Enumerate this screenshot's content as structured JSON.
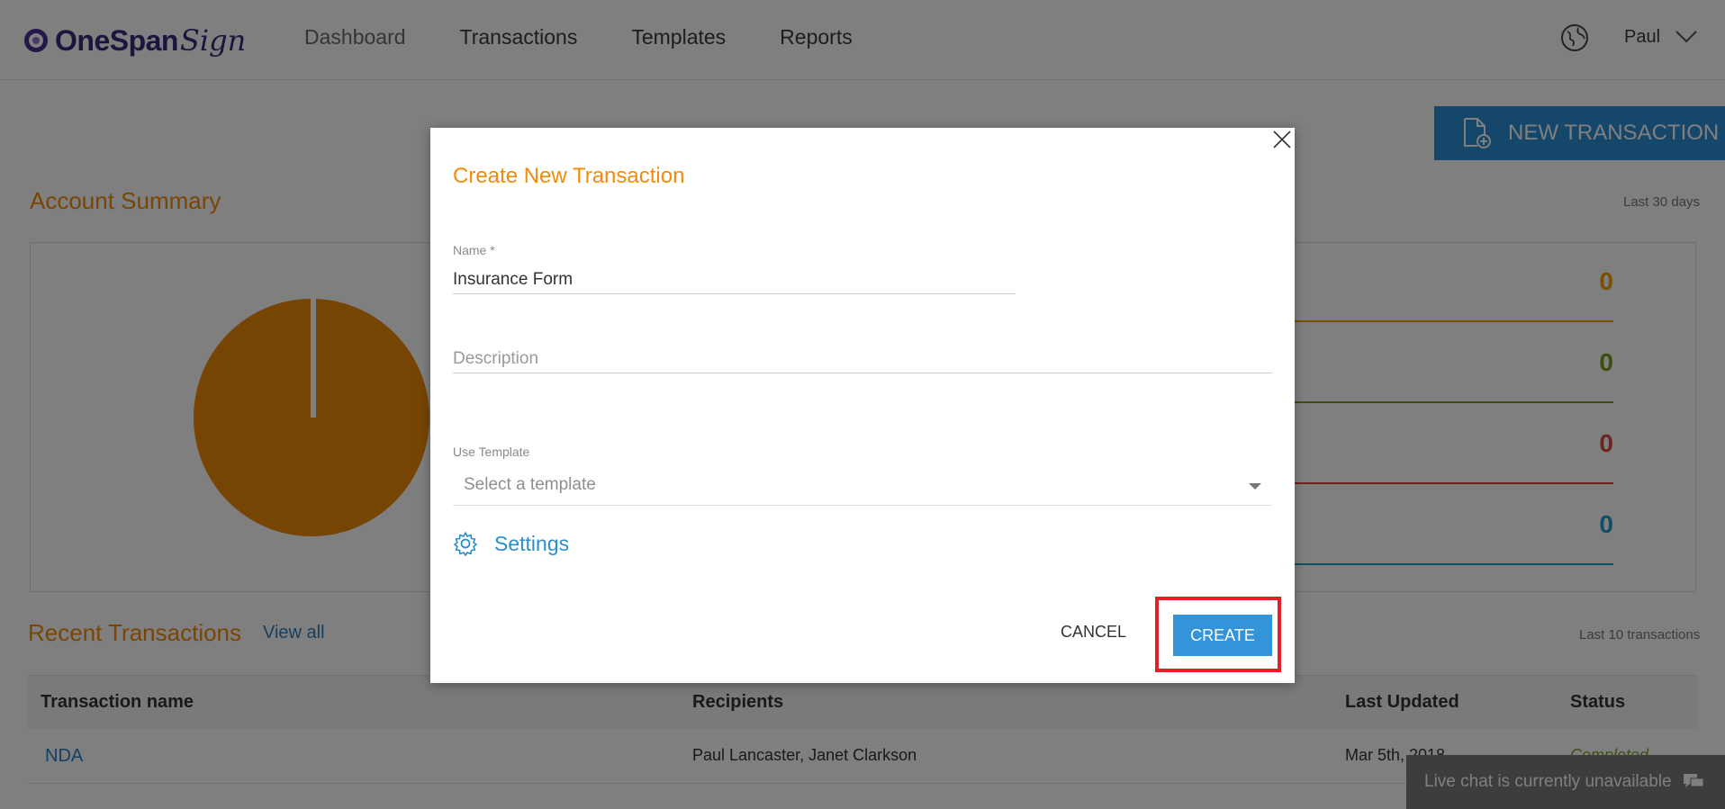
{
  "header": {
    "logo_text": "OneSpan",
    "logo_script": "Sign",
    "nav": [
      "Dashboard",
      "Transactions",
      "Templates",
      "Reports"
    ],
    "user_name": "Paul"
  },
  "page": {
    "new_transaction_label": "NEW TRANSACTION",
    "account_summary_title": "Account Summary",
    "summary_period": "Last 30 days",
    "stats": [
      {
        "value": "0",
        "color": "#f0a500"
      },
      {
        "value": "0",
        "color": "#7a9a1a"
      },
      {
        "value": "0",
        "color": "#d84a3a"
      },
      {
        "value": "0",
        "color": "#1e9fc9"
      }
    ],
    "recent_title": "Recent Transactions",
    "view_all": "View all",
    "recent_note": "Last 10 transactions",
    "table": {
      "headers": [
        "Transaction name",
        "Recipients",
        "Last Updated",
        "Status"
      ],
      "rows": [
        {
          "name": "NDA",
          "recipients": "Paul Lancaster, Janet Clarkson",
          "updated": "Mar 5th, 2018",
          "status": "Completed"
        }
      ]
    },
    "live_chat": "Live chat is currently unavailable"
  },
  "modal": {
    "title": "Create New Transaction",
    "name_label": "Name *",
    "name_value": "Insurance Form",
    "description_placeholder": "Description",
    "template_label": "Use Template",
    "template_placeholder": "Select a template",
    "settings_label": "Settings",
    "cancel_label": "CANCEL",
    "create_label": "CREATE"
  },
  "colors": {
    "accent_orange": "#f28a0a",
    "primary_blue": "#3394d9",
    "highlight_red": "#e32027"
  }
}
